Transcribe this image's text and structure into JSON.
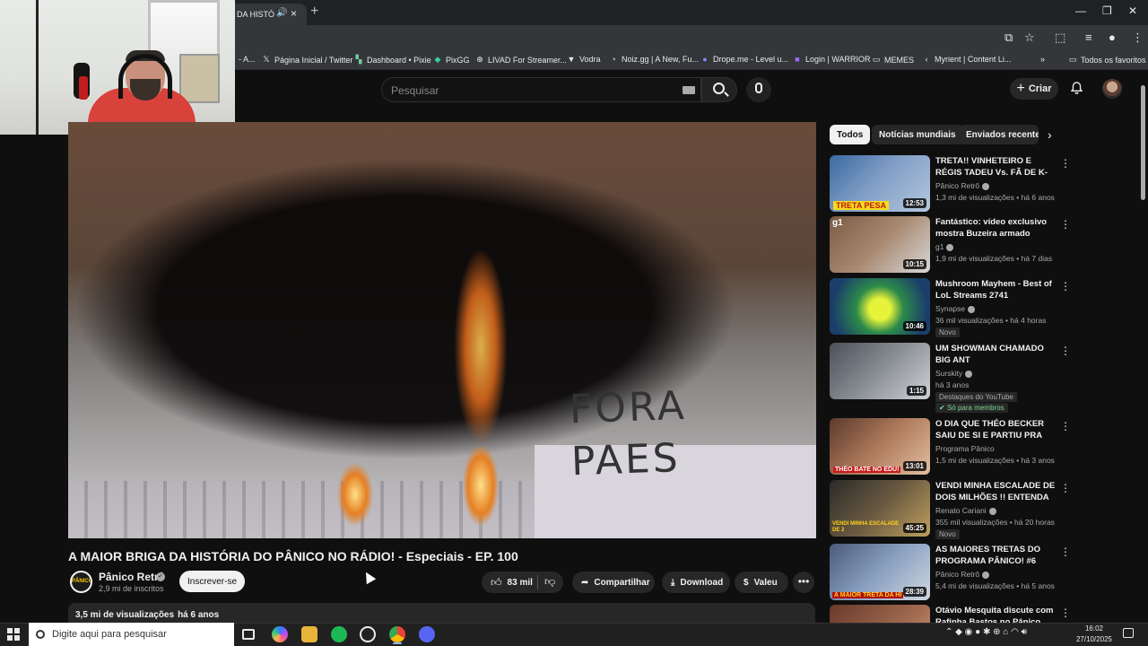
{
  "browser": {
    "active_tab_title": "DA HISTÓ",
    "bookmarks": [
      {
        "label": "- A...",
        "icon": "bookmark-icon"
      },
      {
        "label": "Página Inicial / Twitter",
        "icon": "x-logo-icon"
      },
      {
        "label": "Dashboard • Pixie",
        "icon": "pixie-icon"
      },
      {
        "label": "PixGG",
        "icon": "pixgg-icon"
      },
      {
        "label": "LIVAD For Streamer...",
        "icon": "livad-icon"
      },
      {
        "label": "Vodra",
        "icon": "vodra-icon"
      },
      {
        "label": "Noiz.gg | A New, Fu...",
        "icon": "noiz-icon"
      },
      {
        "label": "Drope.me - Level u...",
        "icon": "drope-icon"
      },
      {
        "label": "Login | WARRIOR",
        "icon": "warrior-icon"
      },
      {
        "label": "MEMES",
        "icon": "folder-icon"
      },
      {
        "label": "Myrient | Content Li...",
        "icon": "myrient-icon"
      }
    ],
    "all_bookmarks_label": "Todos os favoritos"
  },
  "youtube": {
    "search_placeholder": "Pesquisar",
    "create_label": "Criar",
    "video": {
      "graffiti_text": [
        "FORA",
        "PAES"
      ],
      "title": "A MAIOR BRIGA DA HISTÓRIA DO PÂNICO NO RÁDIO! - Especiais - EP. 100",
      "channel_name": "Pânico Retrô",
      "channel_avatar_text": "PÂNICO",
      "subscribers": "2,9 mi de inscritos",
      "subscribe_label": "Inscrever-se",
      "likes": "83 mil",
      "share_label": "Compartilhar",
      "download_label": "Download",
      "thanks_label": "Valeu",
      "views": "3,5 mi de visualizações",
      "published": "há 6 anos"
    },
    "chips": [
      "Todos",
      "Notícias mundiais",
      "Enviados recentem"
    ],
    "recommendations": [
      {
        "title": "TRETA!! VINHETEIRO E RÉGIS TADEU Vs. FÃ DE K-POP! | ...",
        "channel": "Pânico Retrô",
        "views": "1,3 mi de visualizações",
        "age": "há 6 anos",
        "duration": "12:53",
        "thumb_text": "TRETA PESA"
      },
      {
        "title": "Fantástico: vídeo exclusivo mostra Buzeira armado minut...",
        "channel": "g1",
        "views": "1,9 mi de visualizações",
        "age": "há 7 dias",
        "duration": "10:15",
        "thumb_text": "g1"
      },
      {
        "title": "Mushroom Mayhem - Best of LoL Streams 2741",
        "channel": "Synapse",
        "views": "36 mil visualizações",
        "age": "há 4 horas",
        "duration": "10:46",
        "badge": "Novo"
      },
      {
        "title": "UM SHOWMAN CHAMADO BIG ANT",
        "channel": "Surskity",
        "views": "",
        "age": "há 3 anos",
        "duration": "1:15",
        "badge": "Destaques do YouTube",
        "badge2": "Só para membros"
      },
      {
        "title": "O DIA QUE THÉO BECKER SAIU DE SI E PARTIU PRA CIMA DO ...",
        "channel": "Programa Pânico",
        "views": "1,5 mi de visualizações",
        "age": "há 3 anos",
        "duration": "13:01",
        "thumb_text": "THÉO BATE NO EDU!"
      },
      {
        "title": "VENDI MINHA ESCALADE DE DOIS MILHÕES !! ENTENDA O ...",
        "channel": "Renato Cariani",
        "views": "355 mil visualizações",
        "age": "há 20 horas",
        "duration": "45:25",
        "badge": "Novo",
        "thumb_text": "VENDI MINHA ESCALADE DE 2"
      },
      {
        "title": "AS MAIORES TRETAS DO PROGRAMA PÂNICO! #6",
        "channel": "Pânico Retrô",
        "views": "5,4 mi de visualizações",
        "age": "há 5 anos",
        "duration": "28:39",
        "thumb_text": "A MAIOR TRETA DA HI"
      },
      {
        "title": "Otávio Mesquita discute com Rafinha Bastos no Pânico",
        "channel": "",
        "views": "",
        "age": "",
        "duration": ""
      }
    ]
  },
  "taskbar": {
    "search_placeholder": "Digite aqui para pesquisar",
    "time": "16:02",
    "date": "27/10/2025"
  },
  "colors": {
    "background": "#0f0f0f",
    "surface": "#272727",
    "text": "#f1f1f1",
    "muted": "#aaaaaa",
    "accent_member": "#7bd88f"
  }
}
